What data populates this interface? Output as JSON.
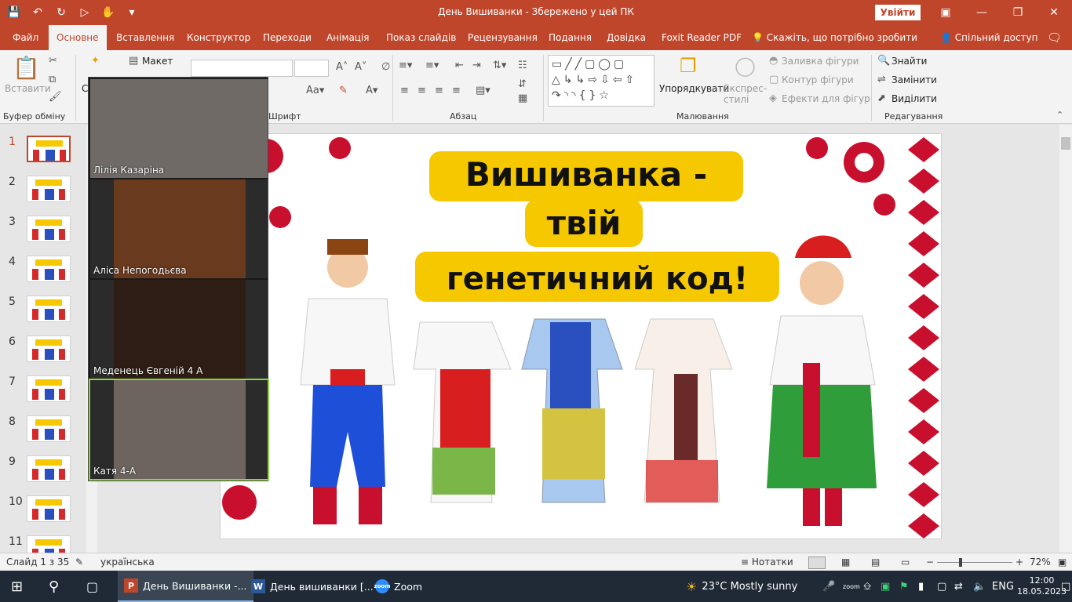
{
  "titlebar": {
    "title": "День Вишиванки  -  Збережено у цей ПК",
    "login_label": "Увійти"
  },
  "tabs": [
    "Файл",
    "Основне",
    "Вставлення",
    "Конструктор",
    "Переходи",
    "Анімація",
    "Показ слайдів",
    "Рецензування",
    "Подання",
    "Довідка",
    "Foxit Reader PDF"
  ],
  "tell_me": "Скажіть, що потрібно зробити",
  "share_label": "Спільний доступ",
  "ribbon": {
    "paste": "Вставити",
    "layout": "Макет",
    "sort": "Упорядкувати",
    "quick_styles": "Експрес-стилі",
    "shape_fill": "Заливка фігури",
    "shape_outline": "Контур фігури",
    "shape_effects": "Ефекти для фігур",
    "find": "Знайти",
    "replace": "Замінити",
    "select": "Виділити",
    "groups": {
      "clipboard": "Буфер обміну",
      "font": "Шрифт",
      "paragraph": "Абзац",
      "drawing": "Малювання",
      "editing": "Редагування"
    },
    "partial_c": "С"
  },
  "slides": [
    "1",
    "2",
    "3",
    "4",
    "5",
    "6",
    "7",
    "8",
    "9",
    "10",
    "11"
  ],
  "slide": {
    "title_line1": "Вишиванка -",
    "title_line2": "твій",
    "title_line3": "генетичний код!"
  },
  "zoom": {
    "participants": [
      "Лілія Казаріна",
      "Аліса Непогодьєва",
      "Меденець Євгеній 4 А",
      "Катя  4-А"
    ]
  },
  "status": {
    "slide_counter": "Слайд 1 з 35",
    "language": "українська",
    "notes": "Нотатки",
    "zoom_level": "72%"
  },
  "taskbar": {
    "apps": [
      "День Вишиванки -...",
      "День вишиванки [...",
      "Zoom"
    ],
    "weather": "23°C  Mostly sunny",
    "lang": "ENG",
    "time": "12:00",
    "date": "18.05.2023"
  },
  "colors": {
    "accent": "#c0462b",
    "title_yellow": "#f5c800"
  }
}
